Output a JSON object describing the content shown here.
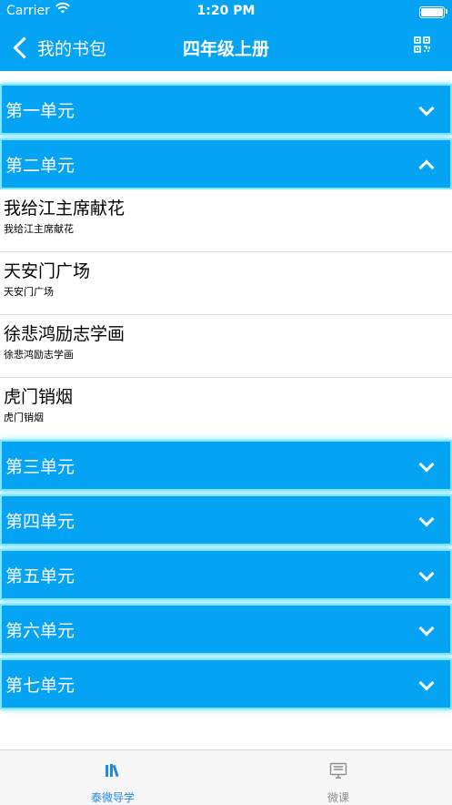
{
  "status_bar": {
    "carrier": "Carrier",
    "time": "1:20 PM"
  },
  "nav": {
    "back_label": "我的书包",
    "title": "四年级上册"
  },
  "units": [
    {
      "label": "第一单元",
      "expanded": false,
      "lessons": []
    },
    {
      "label": "第二单元",
      "expanded": true,
      "lessons": [
        {
          "title": "我给江主席献花",
          "subtitle": "我给江主席献花"
        },
        {
          "title": "天安门广场",
          "subtitle": "天安门广场"
        },
        {
          "title": "徐悲鸿励志学画",
          "subtitle": "徐悲鸿励志学画"
        },
        {
          "title": "虎门销烟",
          "subtitle": "虎门销烟"
        }
      ]
    },
    {
      "label": "第三单元",
      "expanded": false,
      "lessons": []
    },
    {
      "label": "第四单元",
      "expanded": false,
      "lessons": []
    },
    {
      "label": "第五单元",
      "expanded": false,
      "lessons": []
    },
    {
      "label": "第六单元",
      "expanded": false,
      "lessons": []
    },
    {
      "label": "第七单元",
      "expanded": false,
      "lessons": []
    }
  ],
  "tab_bar": {
    "tabs": [
      {
        "label": "泰微导学",
        "icon": "books-icon",
        "active": true
      },
      {
        "label": "微课",
        "icon": "monitor-icon",
        "active": false
      }
    ]
  },
  "colors": {
    "accent": "#05a3f4",
    "tab_active": "#1e88e5",
    "tab_inactive": "#8e8e93"
  }
}
